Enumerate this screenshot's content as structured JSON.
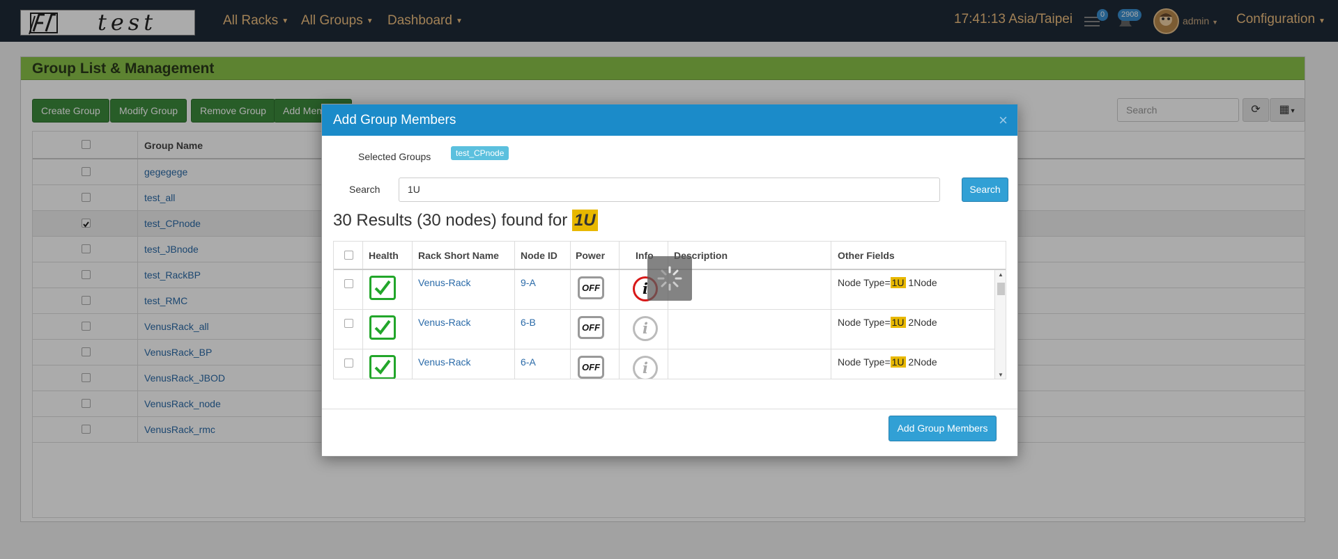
{
  "navbar": {
    "logo_text": "test",
    "menus": [
      {
        "label": "All Racks"
      },
      {
        "label": "All Groups"
      },
      {
        "label": "Dashboard"
      }
    ],
    "time": "17:41:13 Asia/Taipei",
    "messages_count": "0",
    "notifications_count": "2908",
    "user": "admin",
    "config": "Configuration"
  },
  "page": {
    "title": "Group List & Management",
    "buttons": [
      "Create Group",
      "Modify Group",
      "Remove Group",
      "Add Mem"
    ],
    "search_placeholder": "Search",
    "table_header": "Group Name",
    "groups": [
      {
        "name": "gegegege",
        "checked": false
      },
      {
        "name": "test_all",
        "checked": false
      },
      {
        "name": "test_CPnode",
        "checked": true
      },
      {
        "name": "test_JBnode",
        "checked": false
      },
      {
        "name": "test_RackBP",
        "checked": false
      },
      {
        "name": "test_RMC",
        "checked": false
      },
      {
        "name": "VenusRack_all",
        "checked": false
      },
      {
        "name": "VenusRack_BP",
        "checked": false
      },
      {
        "name": "VenusRack_JBOD",
        "checked": false
      },
      {
        "name": "VenusRack_node",
        "checked": false
      },
      {
        "name": "VenusRack_rmc",
        "checked": false
      }
    ]
  },
  "modal": {
    "title": "Add Group Members",
    "close": "×",
    "selected_groups_label": "Selected Groups",
    "selected_group_tag": "test_CPnode",
    "search_label": "Search",
    "search_value": "1U",
    "search_button": "Search",
    "results_prefix": "30 Results (30 nodes) found for",
    "results_term": "1U",
    "columns": [
      "Health",
      "Rack Short Name",
      "Node ID",
      "Power",
      "Info",
      "Description",
      "Other Fields"
    ],
    "rows": [
      {
        "rack": "Venus-Rack",
        "node_id": "9-A",
        "power": "OFF",
        "info_active": true,
        "other_prefix": "Node Type=",
        "other_hl": "1U",
        "other_suffix": " 1Node"
      },
      {
        "rack": "Venus-Rack",
        "node_id": "6-B",
        "power": "OFF",
        "info_active": false,
        "other_prefix": "Node Type=",
        "other_hl": "1U",
        "other_suffix": " 2Node"
      },
      {
        "rack": "Venus-Rack",
        "node_id": "6-A",
        "power": "OFF",
        "info_active": false,
        "other_prefix": "Node Type=",
        "other_hl": "1U",
        "other_suffix": " 2Node"
      }
    ],
    "add_button": "Add Group Members"
  }
}
